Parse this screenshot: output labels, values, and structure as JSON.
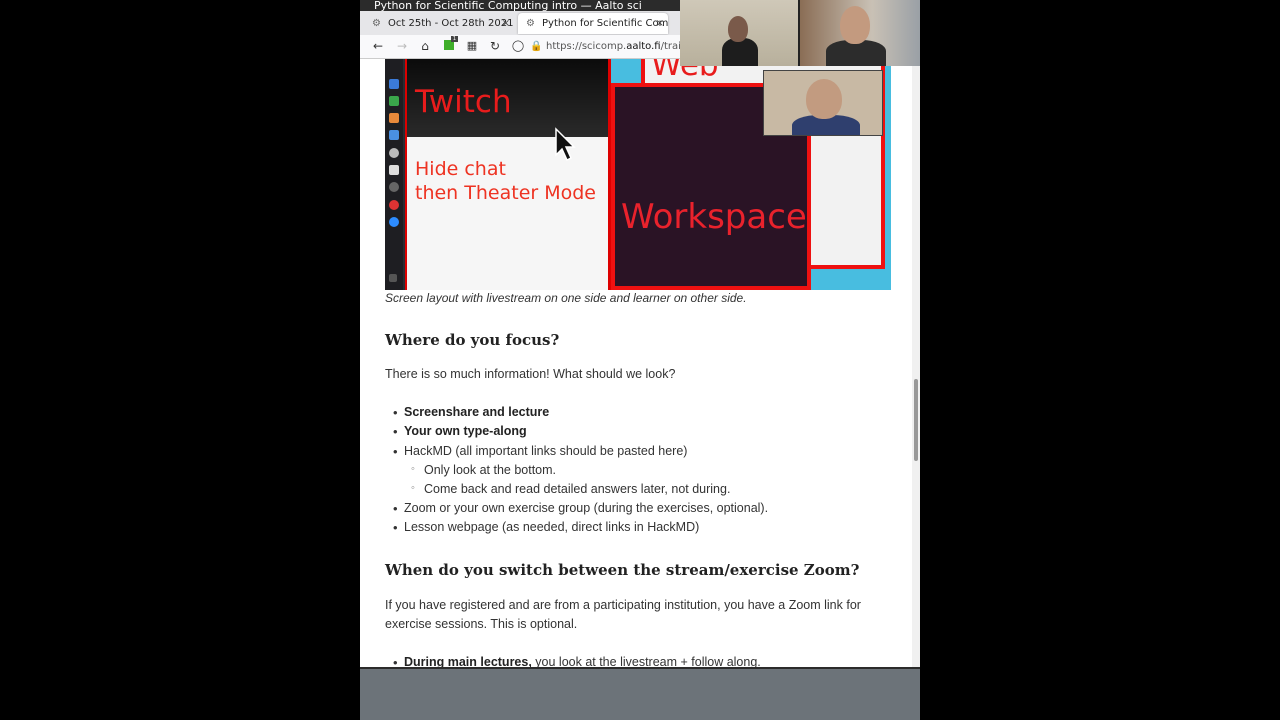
{
  "window": {
    "title": "Python for Scientific Computing intro — Aalto sci"
  },
  "tabs": [
    {
      "label": "Oct 25th - Oct 28th 2021",
      "active": false
    },
    {
      "label": "Python for Scientific Com",
      "active": true
    }
  ],
  "navbar": {
    "url_prefix": "https://scicomp.",
    "url_domain": "aalto.fi",
    "url_suffix": "/trai",
    "extension_badge": "1"
  },
  "figure": {
    "twitch_label": "Twitch",
    "hide_chat_line1": "Hide chat",
    "hide_chat_line2": "then Theater Mode",
    "workspace_label": "Workspace",
    "web_label": "Web",
    "caption": "Screen layout with livestream on one side and learner on other side."
  },
  "section1": {
    "heading": "Where do you focus?",
    "intro": "There is so much information! What should we look?",
    "items": [
      {
        "bold": "Screenshare and lecture",
        "text": ""
      },
      {
        "bold": "Your own type-along",
        "text": ""
      },
      {
        "bold": "",
        "text": "HackMD (all important links should be pasted here)"
      },
      {
        "sub": "Only look at the bottom."
      },
      {
        "sub": "Come back and read detailed answers later, not during."
      },
      {
        "bold": "",
        "text": "Zoom or your own exercise group (during the exercises, optional)."
      },
      {
        "bold": "",
        "text": "Lesson webpage (as needed, direct links in HackMD)"
      }
    ]
  },
  "section2": {
    "heading": "When do you switch between the stream/exercise Zoom?",
    "para_line1": "If you have registered and are from a participating institution, you have a Zoom link for",
    "para_line2": "exercise sessions. This is optional.",
    "partial_item_bold": "During main lectures,",
    "partial_item_text": " you look at the livestream + follow along."
  },
  "colors": {
    "accent_red": "#e81c1c",
    "workspace_bg": "#2a1325",
    "page_bg": "#ffffff",
    "outer_frame": "#6c7379"
  }
}
